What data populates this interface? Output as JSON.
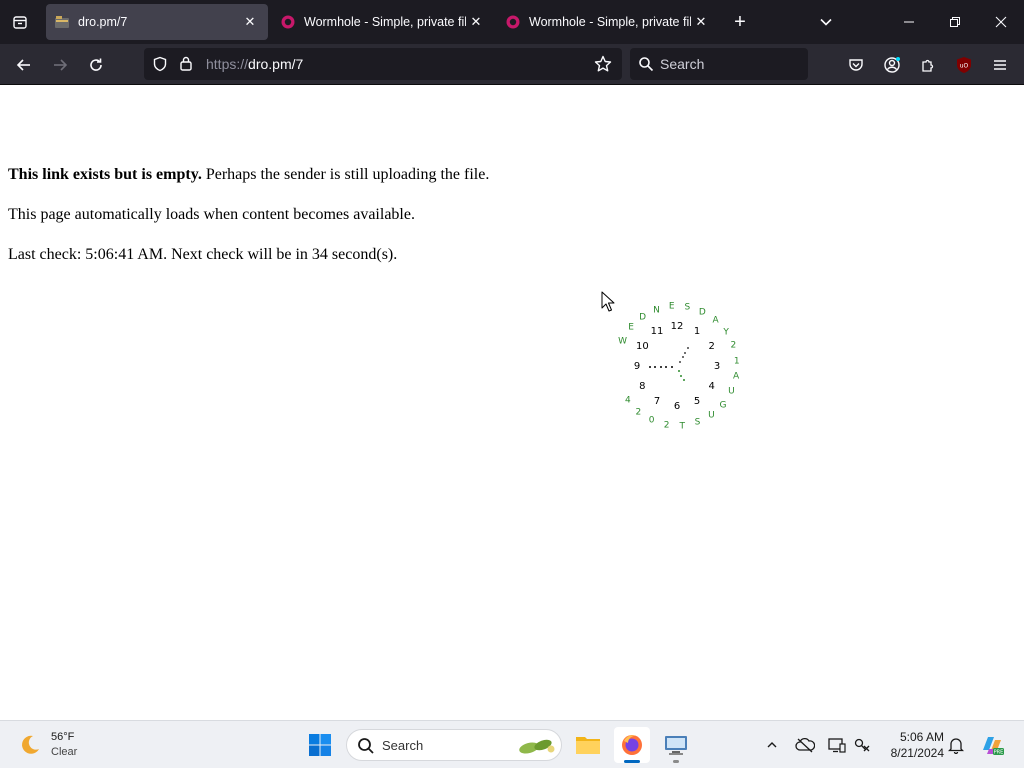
{
  "browser": {
    "tabs": [
      {
        "title": "dro.pm/7",
        "active": true
      },
      {
        "title": "Wormhole - Simple, private file",
        "active": false
      },
      {
        "title": "Wormhole - Simple, private file",
        "active": false
      }
    ],
    "url_scheme": "https://",
    "url_host": "dro.pm/7",
    "search_placeholder": "Search",
    "extension_badge": "uO"
  },
  "page": {
    "line1_bold": "This link exists but is empty.",
    "line1_rest": " Perhaps the sender is still uploading the file.",
    "line2": "This page automatically loads when content becomes available.",
    "line3": "Last check: 5:06:41 AM. Next check will be in 34 second(s)."
  },
  "clock_widget": {
    "numbers": [
      "12",
      "1",
      "2",
      "3",
      "4",
      "5",
      "6",
      "7",
      "8",
      "9",
      "10",
      "11"
    ],
    "outer_text": "WEDNESDAY 21 AUGUST 2024",
    "hour_hand_dots": 5,
    "minute_hand_dots": 4,
    "second_hand_dots": 3
  },
  "taskbar": {
    "weather_temp": "56°F",
    "weather_cond": "Clear",
    "search_label": "Search",
    "time": "5:06 AM",
    "date": "8/21/2024"
  },
  "colors": {
    "chrome_dark": "#1c1b22",
    "toolbar": "#2b2a33",
    "active_tab": "#42414d",
    "clock_green": "#2e8b2e",
    "taskbar_bg": "#eef0f4",
    "accent_blue": "#0067c0"
  },
  "icons": {
    "tab_favicon_1": "folder-stack-icon",
    "tab_favicon_2": "wormhole-icon",
    "tab_favicon_3": "wormhole-icon",
    "weather": "crescent-moon-icon",
    "start": "windows-start-icon"
  }
}
